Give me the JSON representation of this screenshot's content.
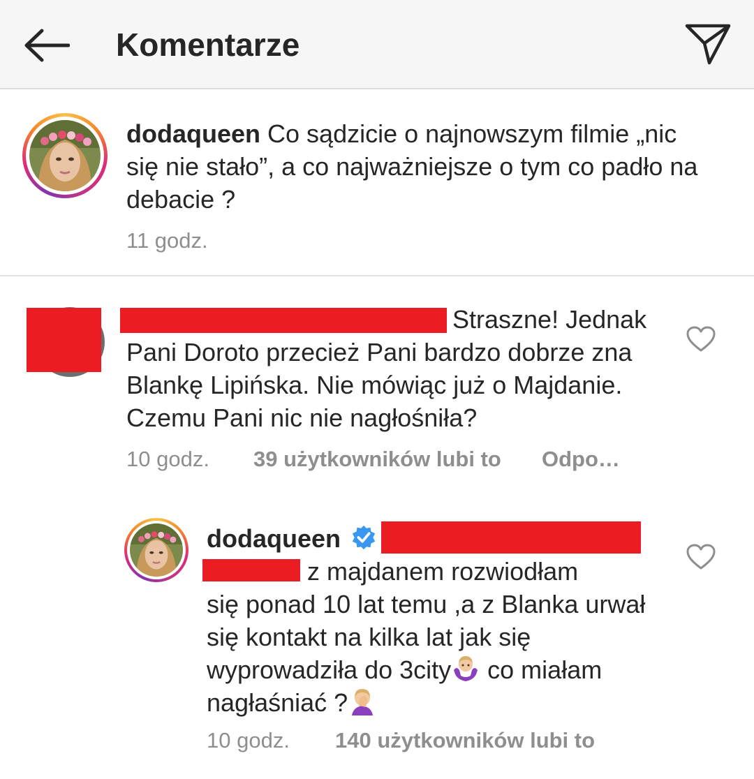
{
  "header": {
    "title": "Komentarze",
    "back_icon": "arrow-left-icon",
    "send_icon": "paper-plane-icon"
  },
  "caption": {
    "username": "dodaqueen",
    "text": "Co sądzicie o najnowszym filmie „nic się nie stało”, a co najważniejsze o tym co padło na debacie ?",
    "time": "11 godz."
  },
  "comment": {
    "text_line1": "Straszne! Jednak",
    "text_rest": "Pani Doroto przecież Pani bardzo dobrze zna Blankę Lipińska. Nie mówiąc już o Majdanie. Czemu Pani nic nie nagłośniła?",
    "time": "10 godz.",
    "likes": "39 użytkowników lubi to",
    "reply": "Odpo…"
  },
  "reply": {
    "username": "dodaqueen",
    "verified_icon": "verified-badge-icon",
    "text_line1": "z majdanem rozwiodłam",
    "text_part2": "się ponad 10 lat temu ,a z Blanka urwał się kontakt na kilka lat jak się wyprowadziła do 3city",
    "text_part3": " co miałam nagłaśniać ?",
    "shrug_emoji": "🤷🏼‍♀️",
    "facepalm_emoji": "🤦🏼‍♀️",
    "time": "10 godz.",
    "likes": "140 użytkowników lubi to"
  },
  "colors": {
    "redaction": "#ec1c24",
    "meta_gray": "#8e8e8e",
    "verified_blue": "#3897f0"
  }
}
